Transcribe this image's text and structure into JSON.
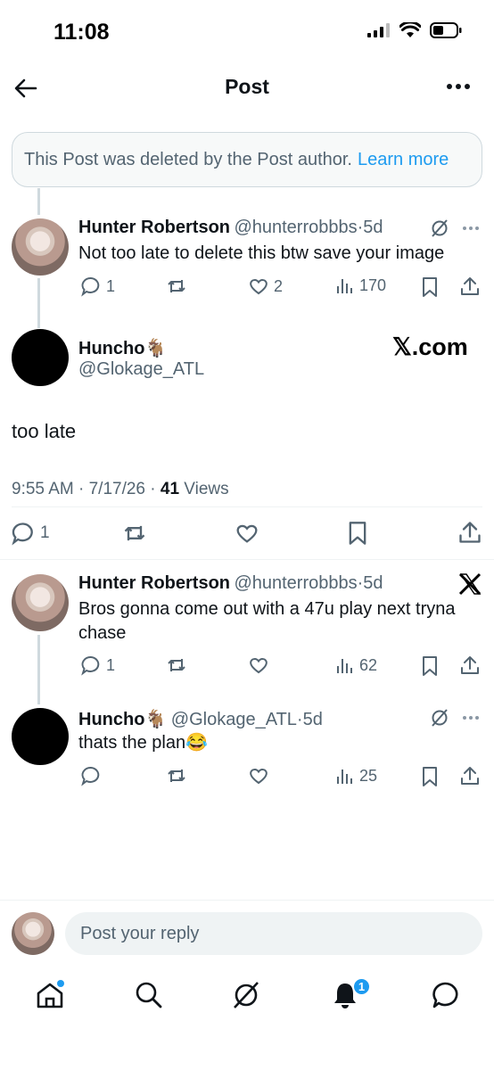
{
  "status": {
    "time": "11:08"
  },
  "header": {
    "title": "Post"
  },
  "notice": {
    "text": "This Post was deleted by the Post author.",
    "link": "Learn more"
  },
  "reply1": {
    "name": "Hunter Robertson",
    "handle": "@hunterrobbbs",
    "age": "5d",
    "text": "Not too late to delete this btw save your image",
    "replies": "1",
    "likes": "2",
    "views": "170"
  },
  "main": {
    "name": "Huncho🐐",
    "handle": "@Glokage_ATL",
    "watermark": "𝕏.com",
    "text": "too late",
    "time": "9:55 AM · 7/17/26 · ",
    "views_count": "41",
    "views_label": " Views",
    "replies": "1"
  },
  "reply2": {
    "name": "Hunter Robertson",
    "handle": "@hunterrobbbs",
    "age": "5d",
    "text": "Bros gonna come out with a 47u play next tryna chase",
    "replies": "1",
    "views": "62"
  },
  "reply3": {
    "name": "Huncho🐐",
    "handle": "@Glokage_ATL",
    "age": "5d",
    "text": "thats the plan😂",
    "views": "25"
  },
  "composer": {
    "placeholder": "Post your reply"
  },
  "tabbar": {
    "notifications_badge": "1"
  },
  "colors": {
    "accent": "#1d9bf0",
    "muted": "#536471",
    "text": "#0f1419"
  }
}
